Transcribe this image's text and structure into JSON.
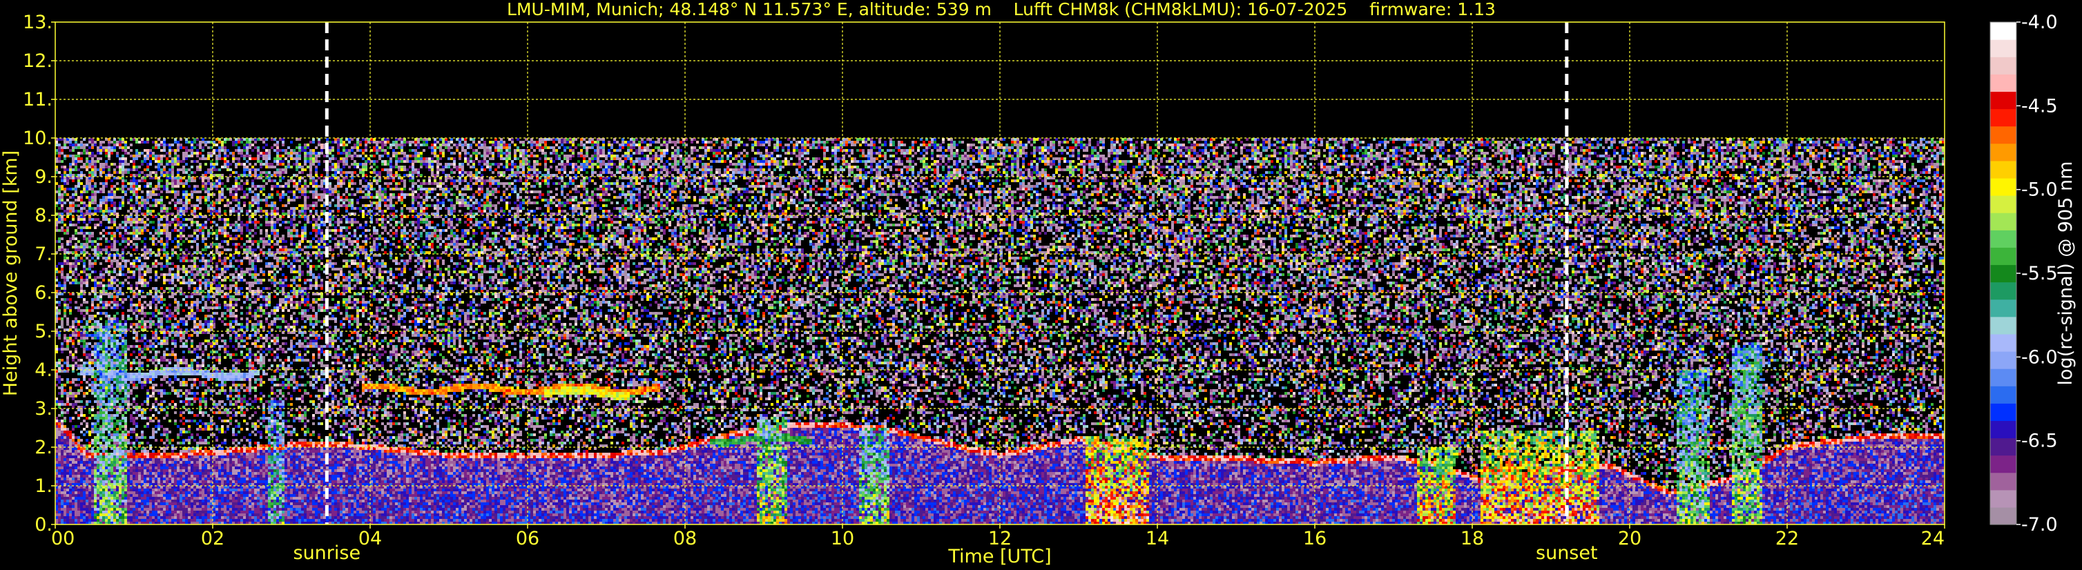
{
  "chart_data": {
    "type": "heatmap",
    "title": "LMU-MIM, Munich; 48.148° N 11.573° E, altitude: 539 m    Lufft CHM8k (CHM8kLMU): 16-07-2025    firmware: 1.13",
    "xlabel": "Time [UTC]",
    "ylabel": "Height above ground [km]",
    "xlim": [
      0,
      24
    ],
    "ylim": [
      0,
      13
    ],
    "x_ticks": [
      0,
      2,
      4,
      6,
      8,
      10,
      12,
      14,
      16,
      18,
      20,
      22,
      24
    ],
    "x_tick_labels": [
      "00",
      "02",
      "04",
      "06",
      "08",
      "10",
      "12",
      "14",
      "16",
      "18",
      "20",
      "22",
      "24"
    ],
    "y_ticks": [
      0,
      1,
      2,
      3,
      4,
      5,
      6,
      7,
      8,
      9,
      10,
      11,
      12,
      13
    ],
    "y_tick_labels": [
      "0.",
      "1.",
      "2.",
      "3.",
      "4.",
      "5.",
      "6.",
      "7.",
      "8.",
      "9.",
      "10.",
      "11.",
      "12.",
      "13."
    ],
    "grid": true,
    "measurement_top_km": 10,
    "sunrise": {
      "time": 3.45,
      "label": "sunrise"
    },
    "sunset": {
      "time": 19.2,
      "label": "sunset"
    },
    "colorbar": {
      "label": "log(rc-signal) @ 905 nm",
      "range": [
        -7.0,
        -4.0
      ],
      "ticks": [
        -4.0,
        -4.5,
        -5.0,
        -5.5,
        -6.0,
        -6.5,
        -7.0
      ],
      "tick_labels": [
        "-4.0",
        "-4.5",
        "-5.0",
        "-5.5",
        "-6.0",
        "-6.5",
        "-7.0"
      ],
      "colors": [
        "#a58fa5",
        "#b793b6",
        "#a0629c",
        "#7c2388",
        "#501a8f",
        "#2a0fbd",
        "#0030ff",
        "#2b6cf0",
        "#5c8bf3",
        "#8ca6f7",
        "#a8b8fa",
        "#9ed4d8",
        "#3fb0a2",
        "#1d9a62",
        "#14881c",
        "#3cb43a",
        "#60d060",
        "#a3e655",
        "#d6f040",
        "#fff500",
        "#ffcf00",
        "#ff9a00",
        "#ff6600",
        "#ff1a00",
        "#e00000",
        "#ffb6b6",
        "#f1c9c9",
        "#f7e0e0",
        "#ffffff"
      ]
    },
    "boundary_layer_top_km": [
      {
        "t": 0.0,
        "h": 2.7
      },
      {
        "t": 0.4,
        "h": 1.8
      },
      {
        "t": 1.0,
        "h": 1.75
      },
      {
        "t": 2.0,
        "h": 1.85
      },
      {
        "t": 3.0,
        "h": 2.05
      },
      {
        "t": 3.45,
        "h": 2.1
      },
      {
        "t": 4.0,
        "h": 2.0
      },
      {
        "t": 5.0,
        "h": 1.8
      },
      {
        "t": 6.0,
        "h": 1.75
      },
      {
        "t": 7.0,
        "h": 1.8
      },
      {
        "t": 7.8,
        "h": 1.9
      },
      {
        "t": 8.5,
        "h": 2.3
      },
      {
        "t": 9.5,
        "h": 2.6
      },
      {
        "t": 10.5,
        "h": 2.5
      },
      {
        "t": 11.5,
        "h": 2.0
      },
      {
        "t": 12.0,
        "h": 1.8
      },
      {
        "t": 13.0,
        "h": 2.2
      },
      {
        "t": 14.0,
        "h": 1.75
      },
      {
        "t": 15.0,
        "h": 1.7
      },
      {
        "t": 16.0,
        "h": 1.6
      },
      {
        "t": 17.0,
        "h": 1.75
      },
      {
        "t": 17.6,
        "h": 1.5
      },
      {
        "t": 18.2,
        "h": 1.1
      },
      {
        "t": 19.0,
        "h": 1.4
      },
      {
        "t": 19.8,
        "h": 1.5
      },
      {
        "t": 20.5,
        "h": 0.8
      },
      {
        "t": 21.5,
        "h": 1.3
      },
      {
        "t": 22.0,
        "h": 2.0
      },
      {
        "t": 23.0,
        "h": 2.25
      },
      {
        "t": 24.0,
        "h": 2.3
      }
    ],
    "elevated_layers": [
      {
        "t_start": 0.3,
        "t_end": 2.6,
        "h": 3.9,
        "intensity": -5.8
      },
      {
        "t_start": 3.9,
        "t_end": 7.7,
        "h": 3.5,
        "intensity": -4.6
      },
      {
        "t_start": 6.2,
        "t_end": 7.3,
        "h": 3.4,
        "intensity": -4.9
      },
      {
        "t_start": 8.3,
        "t_end": 9.6,
        "h": 2.2,
        "intensity": -5.3
      }
    ],
    "precip_events": [
      {
        "t_start": 0.5,
        "t_end": 0.9,
        "h_top": 5.3,
        "intensity": -4.9
      },
      {
        "t_start": 2.7,
        "t_end": 2.9,
        "h_top": 3.2,
        "intensity": -5.0
      },
      {
        "t_start": 8.9,
        "t_end": 9.3,
        "h_top": 2.8,
        "intensity": -4.6
      },
      {
        "t_start": 10.2,
        "t_end": 10.6,
        "h_top": 2.5,
        "intensity": -4.8
      },
      {
        "t_start": 13.1,
        "t_end": 13.9,
        "h_top": 2.3,
        "intensity": -4.1
      },
      {
        "t_start": 17.3,
        "t_end": 17.8,
        "h_top": 2.0,
        "intensity": -4.3
      },
      {
        "t_start": 18.1,
        "t_end": 19.6,
        "h_top": 2.4,
        "intensity": -4.2
      },
      {
        "t_start": 20.6,
        "t_end": 21.0,
        "h_top": 4.0,
        "intensity": -4.9
      },
      {
        "t_start": 21.3,
        "t_end": 21.7,
        "h_top": 4.7,
        "intensity": -4.8
      }
    ]
  }
}
